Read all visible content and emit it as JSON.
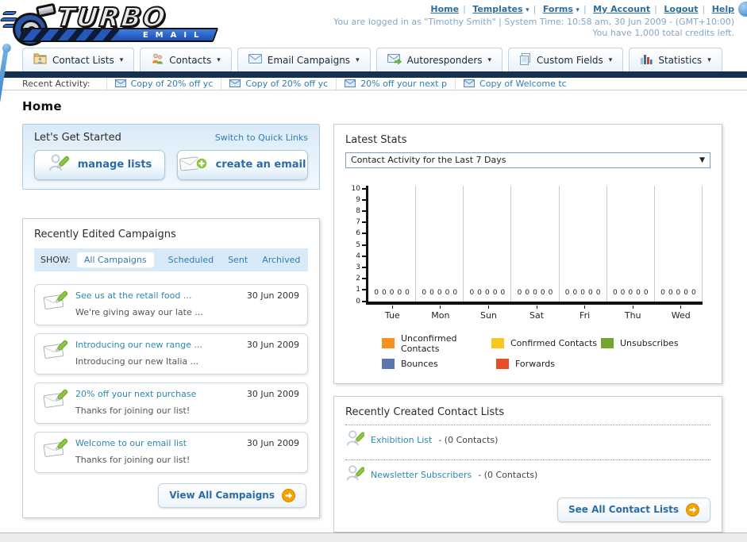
{
  "header": {
    "logo_title": "TURBO",
    "logo_subtitle": "EMAIL",
    "nav": [
      {
        "label": "Home",
        "dropdown": false
      },
      {
        "label": "Templates",
        "dropdown": true
      },
      {
        "label": "Forms",
        "dropdown": true
      },
      {
        "label": "My Account",
        "dropdown": false
      },
      {
        "label": "Logout",
        "dropdown": false
      },
      {
        "label": "Help",
        "dropdown": false
      }
    ],
    "login_info": "You are logged in as \"Timothy Smith\" | System Time: 10:58 am, 30 Jun 2009 - (GMT+10:00)",
    "credits_info": "You have 1,000 total credits left."
  },
  "tabs": [
    {
      "label": "Contact Lists"
    },
    {
      "label": "Contacts"
    },
    {
      "label": "Email Campaigns"
    },
    {
      "label": "Autoresponders"
    },
    {
      "label": "Custom Fields"
    },
    {
      "label": "Statistics"
    }
  ],
  "recent_activity": {
    "label": "Recent Activity:",
    "items": [
      "Copy of 20% off yc",
      "Copy of 20% off yc",
      "20% off your next p",
      "Copy of Welcome tc"
    ]
  },
  "page_title": "Home",
  "get_started": {
    "title": "Let's Get Started",
    "switch_link": "Switch to Quick Links",
    "manage_lists_label": "manage lists",
    "create_email_label": "create an email"
  },
  "campaigns": {
    "title": "Recently Edited Campaigns",
    "show_label": "SHOW:",
    "filters": [
      "All Campaigns",
      "Scheduled",
      "Sent",
      "Archived"
    ],
    "active_filter": "All Campaigns",
    "items": [
      {
        "title": "See us at the retail food ...",
        "subtitle": "We're giving away our late ...",
        "date": "30 Jun 2009"
      },
      {
        "title": "Introducing our new range ...",
        "subtitle": "Introducing our new Italia ...",
        "date": "30 Jun 2009"
      },
      {
        "title": "20% off your next purchase",
        "subtitle": "Thanks for joining our list!",
        "date": "30 Jun 2009"
      },
      {
        "title": "Welcome to our email list",
        "subtitle": "Thanks for joining our list!",
        "date": "30 Jun 2009"
      }
    ],
    "view_all_label": "View All Campaigns"
  },
  "stats": {
    "title": "Latest Stats",
    "dropdown_value": "Contact Activity for the Last 7 Days"
  },
  "chart_data": {
    "type": "bar",
    "title": "Contact Activity for the Last 7 Days",
    "categories": [
      "Tue",
      "Mon",
      "Sun",
      "Sat",
      "Fri",
      "Thu",
      "Wed"
    ],
    "series": [
      {
        "name": "Unconfirmed Contacts",
        "color": "#F6921E",
        "values": [
          0,
          0,
          0,
          0,
          0,
          0,
          0
        ]
      },
      {
        "name": "Confirmed Contacts",
        "color": "#FAC71F",
        "values": [
          0,
          0,
          0,
          0,
          0,
          0,
          0
        ]
      },
      {
        "name": "Unsubscribes",
        "color": "#74A62F",
        "values": [
          0,
          0,
          0,
          0,
          0,
          0,
          0
        ]
      },
      {
        "name": "Bounces",
        "color": "#5C77AE",
        "values": [
          0,
          0,
          0,
          0,
          0,
          0,
          0
        ]
      },
      {
        "name": "Forwards",
        "color": "#E84E29",
        "values": [
          0,
          0,
          0,
          0,
          0,
          0,
          0
        ]
      }
    ],
    "ylim": [
      0,
      10
    ],
    "ytick_step": 1,
    "grid": true,
    "legend_position": "bottom",
    "value_labels_shown": true
  },
  "contact_lists": {
    "title": "Recently Created Contact Lists",
    "items": [
      {
        "name": "Exhibition List",
        "count": "- (0 Contacts)"
      },
      {
        "name": "Newsletter Subscribers",
        "count": "- (0 Contacts)"
      }
    ],
    "see_all_label": "See All Contact Lists"
  }
}
